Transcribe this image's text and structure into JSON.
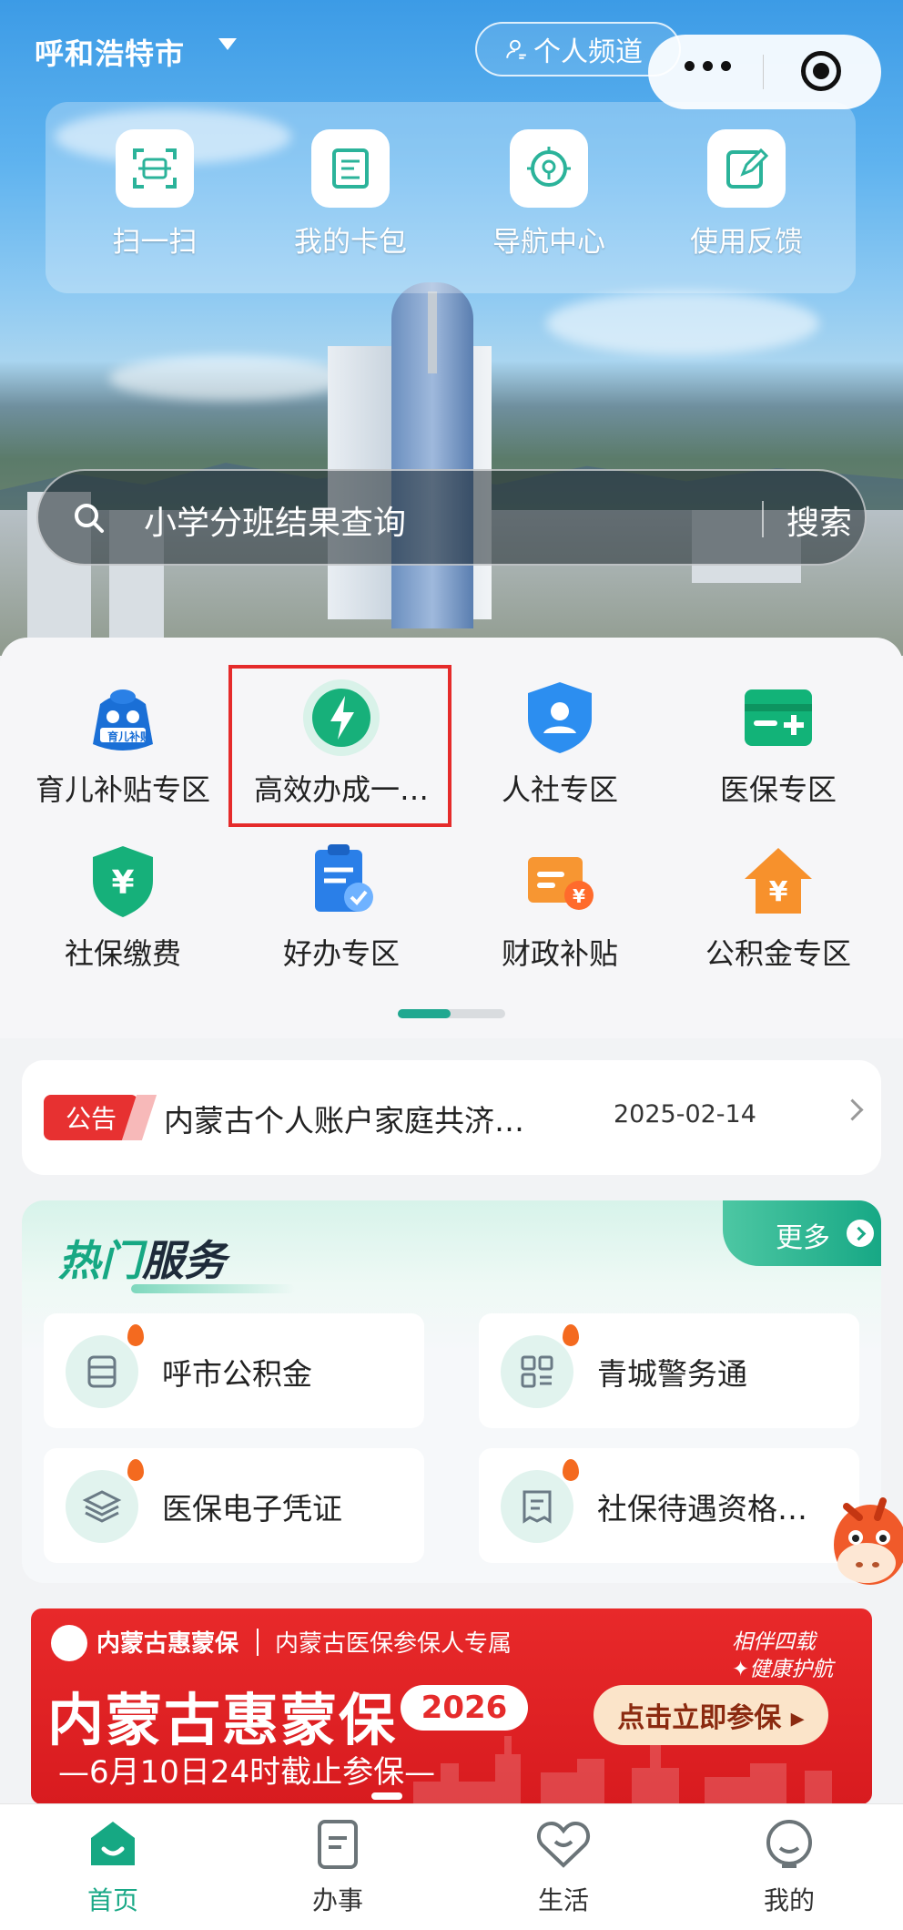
{
  "header": {
    "city": "呼和浩特市",
    "personal_channel": "个人频道"
  },
  "quick_actions": [
    {
      "label": "扫一扫",
      "icon": "scan-icon"
    },
    {
      "label": "我的卡包",
      "icon": "card-wallet-icon"
    },
    {
      "label": "导航中心",
      "icon": "navigation-icon"
    },
    {
      "label": "使用反馈",
      "icon": "feedback-icon"
    }
  ],
  "search": {
    "placeholder": "小学分班结果查询",
    "button": "搜索"
  },
  "service_grid": [
    {
      "label": "育儿补贴专区",
      "icon": "childcare-subsidy-icon",
      "badge": "育儿补贴"
    },
    {
      "label": "高效办成一…",
      "icon": "lightning-icon"
    },
    {
      "label": "人社专区",
      "icon": "hr-social-icon"
    },
    {
      "label": "医保专区",
      "icon": "medical-insurance-icon"
    },
    {
      "label": "社保缴费",
      "icon": "social-security-payment-icon"
    },
    {
      "label": "好办专区",
      "icon": "easy-handle-icon"
    },
    {
      "label": "财政补贴",
      "icon": "fiscal-subsidy-icon"
    },
    {
      "label": "公积金专区",
      "icon": "housing-fund-icon"
    }
  ],
  "notice": {
    "tag": "公告",
    "text": "内蒙古个人账户家庭共济…",
    "date": "2025-02-14"
  },
  "hot_services": {
    "title_a": "热门",
    "title_b": "服务",
    "more": "更多",
    "items": [
      {
        "label": "呼市公积金",
        "icon": "database-icon"
      },
      {
        "label": "青城警务通",
        "icon": "grid-apps-icon"
      },
      {
        "label": "医保电子凭证",
        "icon": "layers-icon"
      },
      {
        "label": "社保待遇资格…",
        "icon": "document-icon"
      }
    ]
  },
  "banner": {
    "brand": "内蒙古惠蒙保",
    "subtitle": "内蒙古医保参保人专属",
    "slogan_1": "相伴四载",
    "slogan_2": "✦健康护航",
    "title": "内蒙古惠蒙保",
    "year": "2026",
    "deadline": "—6月10日24时截止参保—",
    "cta": "点击立即参保 ▸"
  },
  "tabbar": [
    {
      "label": "首页",
      "icon": "home-icon",
      "active": true
    },
    {
      "label": "办事",
      "icon": "tasks-icon",
      "active": false
    },
    {
      "label": "生活",
      "icon": "heart-icon",
      "active": false
    },
    {
      "label": "我的",
      "icon": "profile-icon",
      "active": false
    }
  ],
  "colors": {
    "accent": "#1aa987",
    "notice_red": "#e73131",
    "highlight_box": "#e52b2b"
  }
}
